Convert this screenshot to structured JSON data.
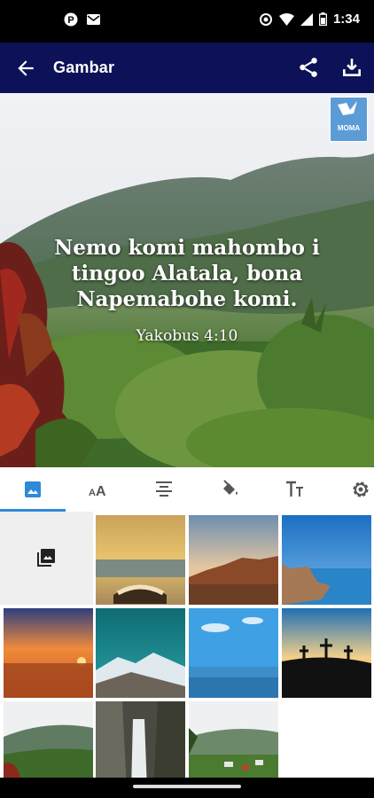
{
  "status_bar": {
    "time": "1:34"
  },
  "app_bar": {
    "title": "Gambar"
  },
  "preview": {
    "verse_text": "Nemo komi mahombo i tingoo Alatala, bona Napemabohe komi.",
    "reference": "Yakobus 4:10",
    "logo_text": "MOMA"
  },
  "tabs": [
    {
      "name": "background-image",
      "icon": "image-icon",
      "selected": true
    },
    {
      "name": "font",
      "icon": "font-icon",
      "selected": false
    },
    {
      "name": "align",
      "icon": "align-center-icon",
      "selected": false
    },
    {
      "name": "color",
      "icon": "paint-bucket-icon",
      "selected": false
    },
    {
      "name": "text-size",
      "icon": "text-size-icon",
      "selected": false
    },
    {
      "name": "settings",
      "icon": "gear-icon",
      "selected": false
    }
  ],
  "grid": {
    "pick_icon": "photo-library-icon",
    "images": [
      "open-book-at-lake",
      "coastal-rocks-sunset",
      "blue-sea-rocks",
      "orange-sunset-sea",
      "snowy-mountains",
      "blue-sky-sea",
      "three-crosses-sunset",
      "green-hills",
      "waterfall-cliff",
      "hillside-village"
    ]
  },
  "colors": {
    "app_bar": "#0d1157",
    "accent": "#2f89d8"
  }
}
